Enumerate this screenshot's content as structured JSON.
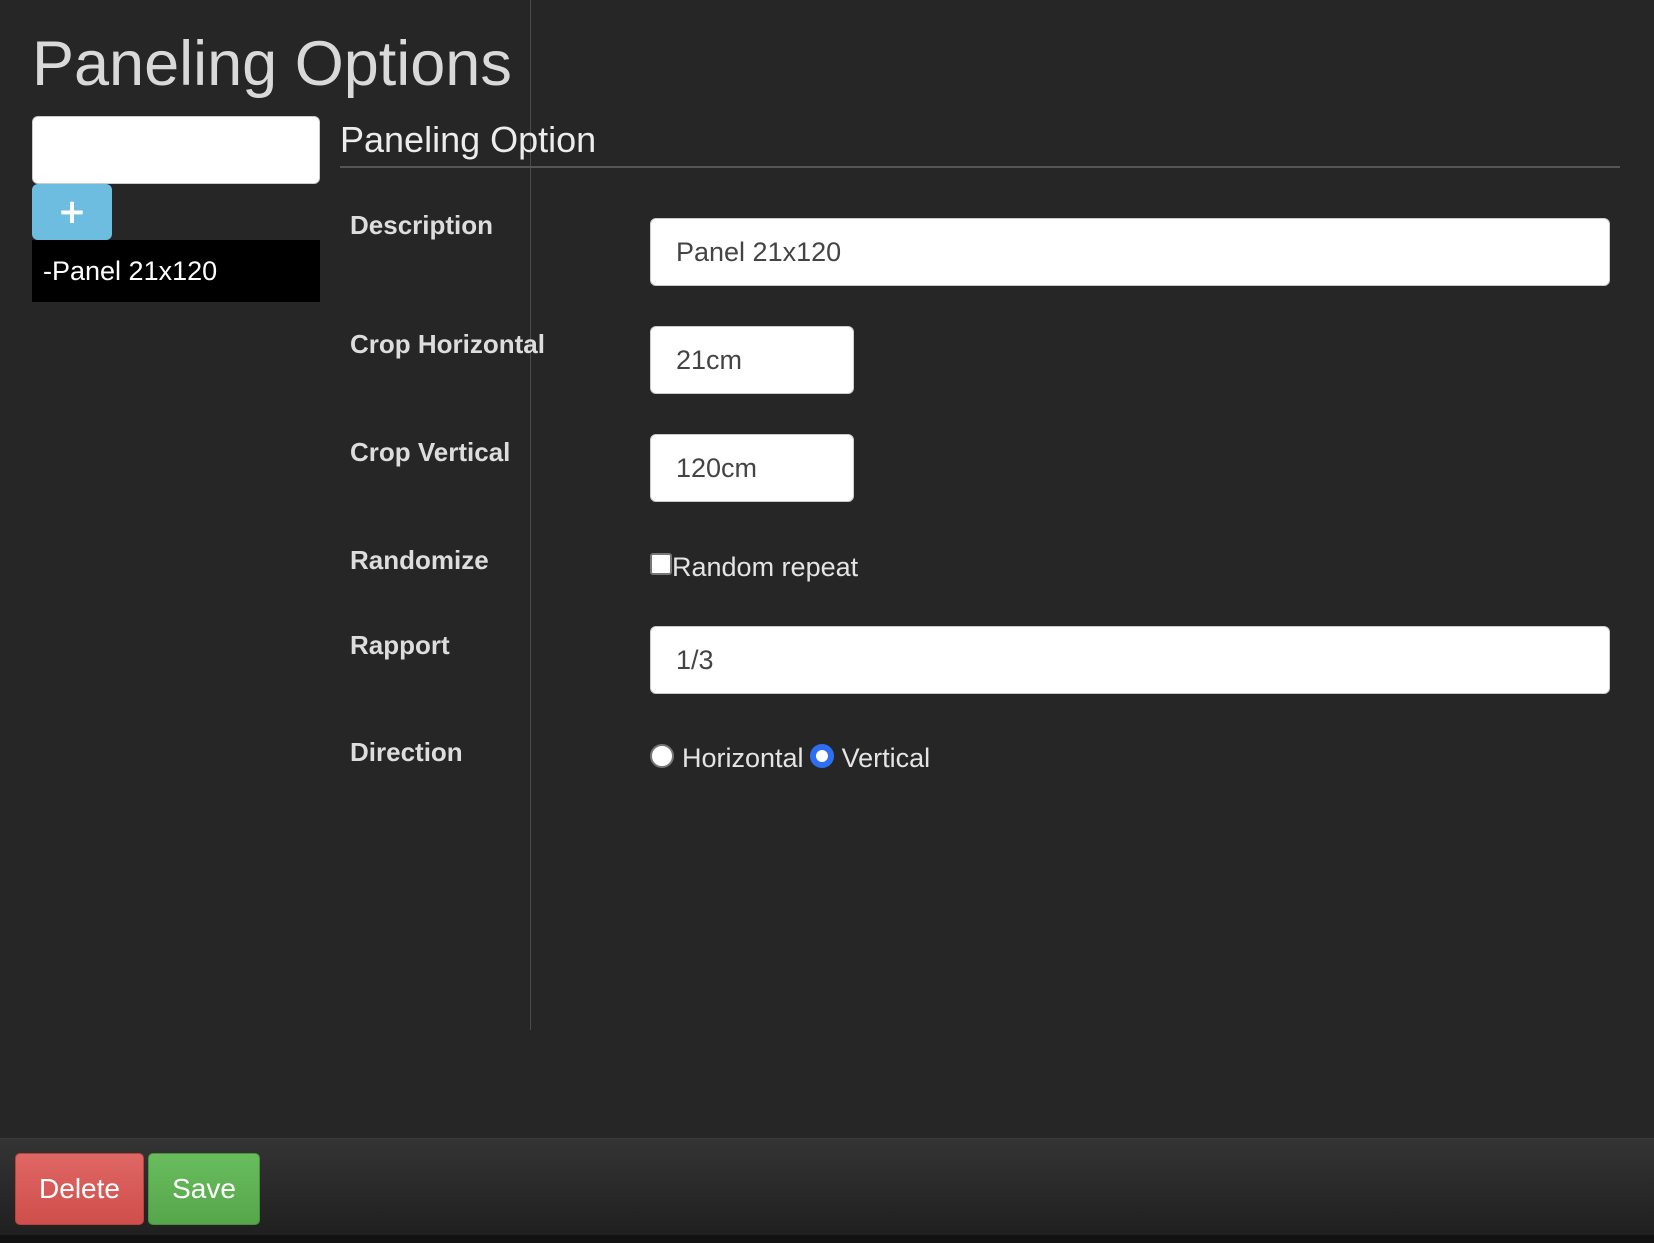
{
  "page": {
    "title": "Paneling Options"
  },
  "sidebar": {
    "search_value": "",
    "add_label": "+",
    "items": [
      {
        "label": "-Panel 21x120"
      }
    ]
  },
  "form": {
    "heading": "Paneling Option",
    "description": {
      "label": "Description",
      "value": "Panel 21x120"
    },
    "crop_horizontal": {
      "label": "Crop Horizontal",
      "value": "21cm"
    },
    "crop_vertical": {
      "label": "Crop Vertical",
      "value": "120cm"
    },
    "randomize": {
      "label": "Randomize",
      "option_label": "Random repeat",
      "checked": false
    },
    "rapport": {
      "label": "Rapport",
      "value": "1/3"
    },
    "direction": {
      "label": "Direction",
      "options": [
        "Horizontal",
        "Vertical"
      ],
      "selected": "Vertical"
    }
  },
  "footer": {
    "delete_label": "Delete",
    "save_label": "Save"
  },
  "colors": {
    "background": "#262626",
    "add_button": "#6cbddf",
    "delete_button": "#d9534f",
    "save_button": "#5cb85c",
    "radio_selected": "#2d6ef4"
  }
}
